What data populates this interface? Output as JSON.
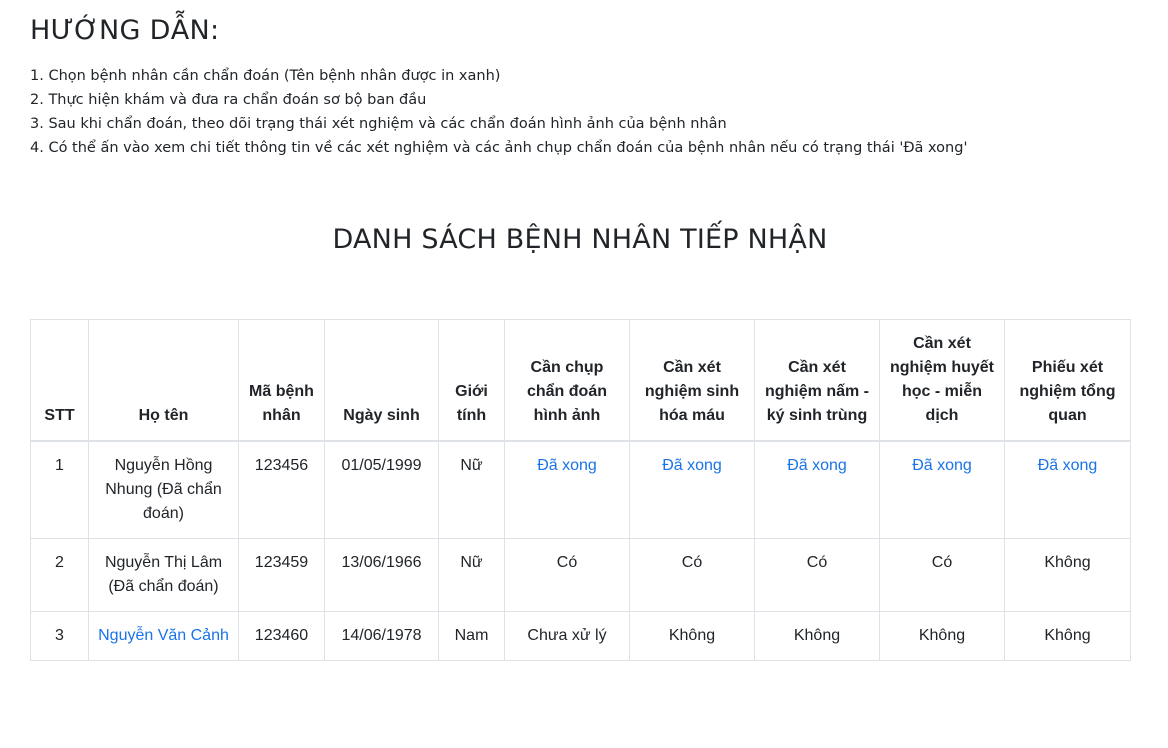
{
  "guide": {
    "title": "HƯỚNG DẪN:",
    "steps": [
      "1. Chọn bệnh nhân cần chẩn đoán (Tên bệnh nhân được in xanh)",
      "2. Thực hiện khám và đưa ra chẩn đoán sơ bộ ban đầu",
      "3. Sau khi chẩn đoán, theo dõi trạng thái xét nghiệm và các chẩn đoán hình ảnh của bệnh nhân",
      "4. Có thể ấn vào xem chi tiết thông tin về các xét nghiệm và các ảnh chụp chẩn đoán của bệnh nhân nếu có trạng thái 'Đã xong'"
    ]
  },
  "list_title": "DANH SÁCH BỆNH NHÂN TIẾP NHẬN",
  "table": {
    "headers": [
      "STT",
      "Họ tên",
      "Mã bệnh nhân",
      "Ngày sinh",
      "Giới tính",
      "Cần chụp chẩn đoán hình ảnh",
      "Cần xét nghiệm sinh hóa máu",
      "Cần xét nghiệm nấm - ký sinh trùng",
      "Cần xét nghiệm huyết học - miễn dịch",
      "Phiếu xét nghiệm tổng quan"
    ],
    "rows": [
      {
        "stt": "1",
        "name": "Nguyễn Hồng Nhung (Đã chẩn đoán)",
        "code": "123456",
        "dob": "01/05/1999",
        "gender": "Nữ",
        "imaging": "Đã xong",
        "biochem": "Đã xong",
        "parasite": "Đã xong",
        "hematology": "Đã xong",
        "overview": "Đã xong"
      },
      {
        "stt": "2",
        "name": "Nguyễn Thị Lâm (Đã chẩn đoán)",
        "code": "123459",
        "dob": "13/06/1966",
        "gender": "Nữ",
        "imaging": "Có",
        "biochem": "Có",
        "parasite": "Có",
        "hematology": "Có",
        "overview": "Không"
      },
      {
        "stt": "3",
        "name": "Nguyễn Văn Cảnh",
        "code": "123460",
        "dob": "14/06/1978",
        "gender": "Nam",
        "imaging": "Chưa xử lý",
        "biochem": "Không",
        "parasite": "Không",
        "hematology": "Không",
        "overview": "Không"
      }
    ]
  },
  "colors": {
    "link": "#1a73e8",
    "text": "#212529",
    "border": "#dee2e6"
  }
}
